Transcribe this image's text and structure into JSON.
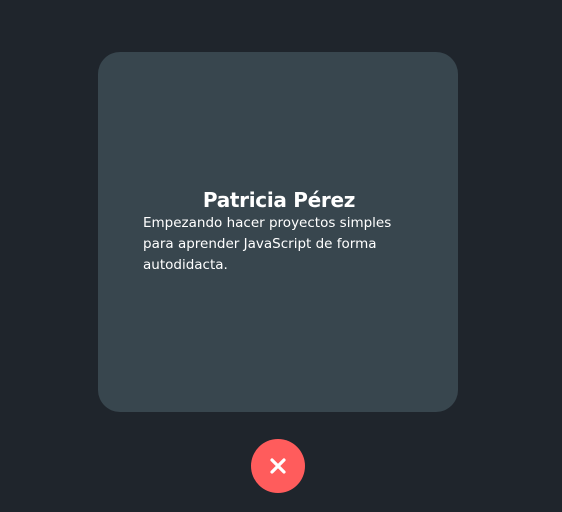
{
  "profile_card": {
    "name": "Patricia Pérez",
    "bio": "Empezando hacer proyectos simples para aprender JavaScript de forma autodidacta."
  },
  "close_button": {
    "icon": "close-icon"
  },
  "colors": {
    "background": "#1f252c",
    "card": "#38464e",
    "text": "#ffffff",
    "accent": "#ff5c5c"
  }
}
